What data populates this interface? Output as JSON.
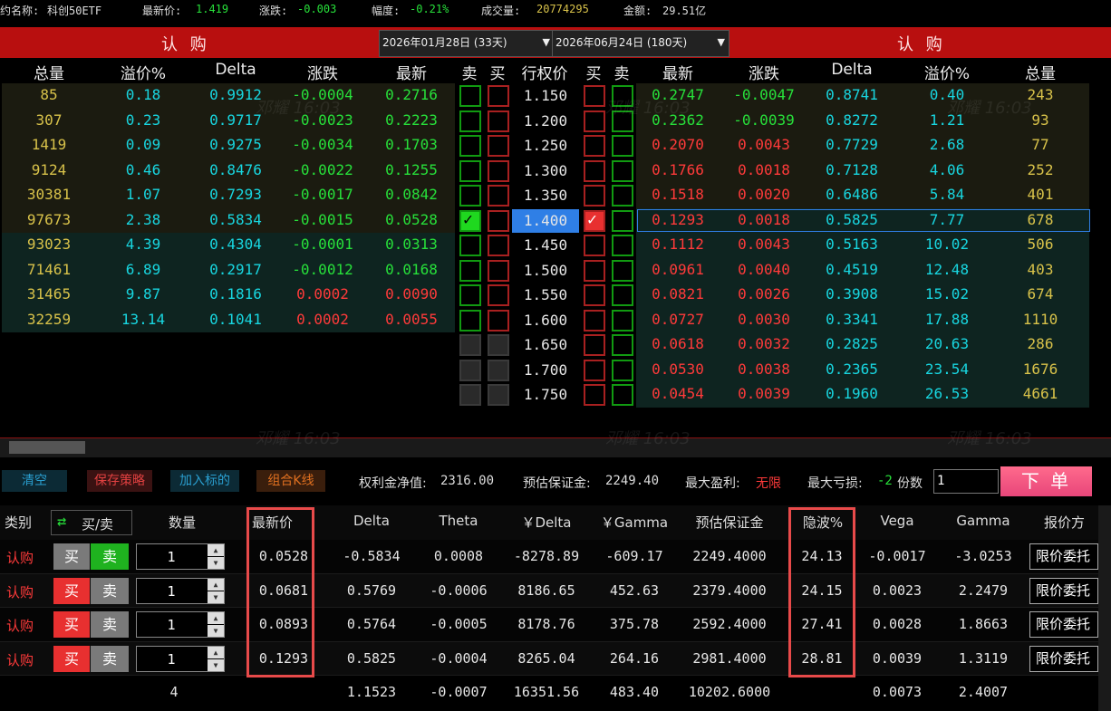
{
  "topbar": {
    "name_label": "约名称:",
    "name_value": "科创50ETF",
    "last_label": "最新价:",
    "last_value": "1.419",
    "change_label": "涨跌:",
    "change_value": "-0.003",
    "pct_label": "幅度:",
    "pct_value": "-0.21%",
    "volume_label": "成交量:",
    "volume_value": "20774295",
    "amount_label": "金额:",
    "amount_value": "29.51亿"
  },
  "header": {
    "left_title": "认 购",
    "right_title": "认 购",
    "date_left": "2026年01月28日 (33天)",
    "date_right": "2026年06月24日 (180天)",
    "dropdown_glyph": "▼"
  },
  "columns": {
    "left": [
      "总量",
      "溢价%",
      "Delta",
      "涨跌",
      "最新"
    ],
    "mid": [
      "卖",
      "买",
      "行权价",
      "买",
      "卖"
    ],
    "right": [
      "最新",
      "涨跌",
      "Delta",
      "溢价%",
      "总量"
    ]
  },
  "rows": [
    {
      "strike": "1.150",
      "left": [
        "85",
        "0.18",
        "0.9912",
        "-0.0004",
        "0.2716"
      ],
      "right": [
        "0.2747",
        "-0.0047",
        "0.8741",
        "0.40",
        "243"
      ]
    },
    {
      "strike": "1.200",
      "left": [
        "307",
        "0.23",
        "0.9717",
        "-0.0023",
        "0.2223"
      ],
      "right": [
        "0.2362",
        "-0.0039",
        "0.8272",
        "1.21",
        "93"
      ]
    },
    {
      "strike": "1.250",
      "left": [
        "1419",
        "0.09",
        "0.9275",
        "-0.0034",
        "0.1703"
      ],
      "right": [
        "0.2070",
        "0.0043",
        "0.7729",
        "2.68",
        "77"
      ]
    },
    {
      "strike": "1.300",
      "left": [
        "9124",
        "0.46",
        "0.8476",
        "-0.0022",
        "0.1255"
      ],
      "right": [
        "0.1766",
        "0.0018",
        "0.7128",
        "4.06",
        "252"
      ]
    },
    {
      "strike": "1.350",
      "left": [
        "30381",
        "1.07",
        "0.7293",
        "-0.0017",
        "0.0842"
      ],
      "right": [
        "0.1518",
        "0.0020",
        "0.6486",
        "5.84",
        "401"
      ]
    },
    {
      "strike": "1.400",
      "left": [
        "97673",
        "2.38",
        "0.5834",
        "-0.0015",
        "0.0528"
      ],
      "right": [
        "0.1293",
        "0.0018",
        "0.5825",
        "7.77",
        "678"
      ]
    },
    {
      "strike": "1.450",
      "left": [
        "93023",
        "4.39",
        "0.4304",
        "-0.0001",
        "0.0313"
      ],
      "right": [
        "0.1112",
        "0.0043",
        "0.5163",
        "10.02",
        "506"
      ]
    },
    {
      "strike": "1.500",
      "left": [
        "71461",
        "6.89",
        "0.2917",
        "-0.0012",
        "0.0168"
      ],
      "right": [
        "0.0961",
        "0.0040",
        "0.4519",
        "12.48",
        "403"
      ]
    },
    {
      "strike": "1.550",
      "left": [
        "31465",
        "9.87",
        "0.1816",
        "0.0002",
        "0.0090"
      ],
      "right": [
        "0.0821",
        "0.0026",
        "0.3908",
        "15.02",
        "674"
      ]
    },
    {
      "strike": "1.600",
      "left": [
        "32259",
        "13.14",
        "0.1041",
        "0.0002",
        "0.0055"
      ],
      "right": [
        "0.0727",
        "0.0030",
        "0.3341",
        "17.88",
        "1110"
      ]
    },
    {
      "strike": "1.650",
      "left": [
        "",
        "",
        "",
        "",
        ""
      ],
      "right": [
        "0.0618",
        "0.0032",
        "0.2825",
        "20.63",
        "286"
      ]
    },
    {
      "strike": "1.700",
      "left": [
        "",
        "",
        "",
        "",
        ""
      ],
      "right": [
        "0.0530",
        "0.0038",
        "0.2365",
        "23.54",
        "1676"
      ]
    },
    {
      "strike": "1.750",
      "left": [
        "",
        "",
        "",
        "",
        ""
      ],
      "right": [
        "0.0454",
        "0.0039",
        "0.1960",
        "26.53",
        "4661"
      ]
    }
  ],
  "checkmark": "✓",
  "watermark": "邓耀 16:03",
  "toolbar": {
    "clear": "清空",
    "save": "保存策略",
    "add": "加入标的",
    "combo": "组合K线",
    "equity_label": "权利金净值:",
    "equity_value": "2316.00",
    "margin_label": "预估保证金:",
    "margin_value": "2249.40",
    "maxprofit_label": "最大盈利:",
    "maxprofit_value": "无限",
    "maxloss_label": "最大亏损:",
    "maxloss_value": "-2",
    "qty_label": "份数",
    "qty_value": "1",
    "order_button": "下 单"
  },
  "bottom": {
    "headers": [
      "类别",
      "买/卖",
      "数量",
      "最新价",
      "Delta",
      "Theta",
      "￥Delta",
      "￥Gamma",
      "预估保证金",
      "隐波%",
      "Vega",
      "Gamma",
      "报价方"
    ],
    "swap_icon": "⇄",
    "rows": [
      {
        "type": "认购",
        "buy": "买",
        "sell": "卖",
        "qty": "1",
        "last": "0.0528",
        "delta": "-0.5834",
        "theta": "0.0008",
        "ydelta": "-8278.89",
        "ygamma": "-609.17",
        "margin": "2249.4000",
        "iv": "24.13",
        "vega": "-0.0017",
        "gamma": "-3.0253",
        "quote": "限价委托"
      },
      {
        "type": "认购",
        "buy": "买",
        "sell": "卖",
        "qty": "1",
        "last": "0.0681",
        "delta": "0.5769",
        "theta": "-0.0006",
        "ydelta": "8186.65",
        "ygamma": "452.63",
        "margin": "2379.4000",
        "iv": "24.15",
        "vega": "0.0023",
        "gamma": "2.2479",
        "quote": "限价委托"
      },
      {
        "type": "认购",
        "buy": "买",
        "sell": "卖",
        "qty": "1",
        "last": "0.0893",
        "delta": "0.5764",
        "theta": "-0.0005",
        "ydelta": "8178.76",
        "ygamma": "375.78",
        "margin": "2592.4000",
        "iv": "27.41",
        "vega": "0.0028",
        "gamma": "1.8663",
        "quote": "限价委托"
      },
      {
        "type": "认购",
        "buy": "买",
        "sell": "卖",
        "qty": "1",
        "last": "0.1293",
        "delta": "0.5825",
        "theta": "-0.0004",
        "ydelta": "8265.04",
        "ygamma": "264.16",
        "margin": "2981.4000",
        "iv": "28.81",
        "vega": "0.0039",
        "gamma": "1.3119",
        "quote": "限价委托"
      }
    ],
    "total": {
      "qty": "4",
      "delta": "1.1523",
      "theta": "-0.0007",
      "ydelta": "16351.56",
      "ygamma": "483.40",
      "margin": "10202.6000",
      "vega": "0.0073",
      "gamma": "2.4007"
    },
    "spin_up": "▲",
    "spin_down": "▼"
  },
  "colors": {
    "header_red": "#b80f0f",
    "up": "#ff3a3a",
    "down": "#27e03a",
    "volume": "#d8c24a",
    "cyan": "#18d6e0",
    "order_pink": "#f05a8a",
    "highlight_box": "#e84a4a",
    "selected_strike": "#2f7fe6"
  }
}
